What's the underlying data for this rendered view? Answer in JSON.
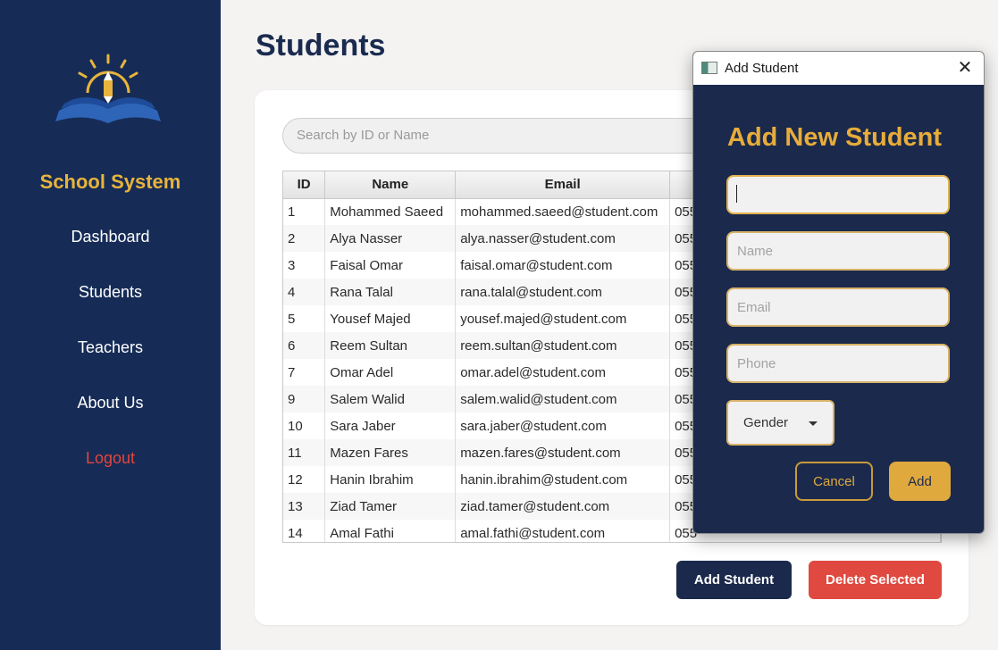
{
  "sidebar": {
    "brand": "School System",
    "items": [
      {
        "label": "Dashboard"
      },
      {
        "label": "Students"
      },
      {
        "label": "Teachers"
      },
      {
        "label": "About Us"
      },
      {
        "label": "Logout"
      }
    ]
  },
  "main": {
    "title": "Students",
    "search_placeholder": "Search by ID or Name",
    "columns": [
      "ID",
      "Name",
      "Email",
      ""
    ],
    "rows": [
      {
        "id": "1",
        "name": "Mohammed Saeed",
        "email": "mohammed.saeed@student.com",
        "phone": "055"
      },
      {
        "id": "2",
        "name": "Alya Nasser",
        "email": "alya.nasser@student.com",
        "phone": "055"
      },
      {
        "id": "3",
        "name": "Faisal Omar",
        "email": "faisal.omar@student.com",
        "phone": "055"
      },
      {
        "id": "4",
        "name": "Rana Talal",
        "email": "rana.talal@student.com",
        "phone": "055"
      },
      {
        "id": "5",
        "name": "Yousef Majed",
        "email": "yousef.majed@student.com",
        "phone": "055"
      },
      {
        "id": "6",
        "name": "Reem Sultan",
        "email": "reem.sultan@student.com",
        "phone": "055"
      },
      {
        "id": "7",
        "name": "Omar Adel",
        "email": "omar.adel@student.com",
        "phone": "055"
      },
      {
        "id": "9",
        "name": "Salem Walid",
        "email": "salem.walid@student.com",
        "phone": "055"
      },
      {
        "id": "10",
        "name": "Sara Jaber",
        "email": "sara.jaber@student.com",
        "phone": "055"
      },
      {
        "id": "11",
        "name": "Mazen Fares",
        "email": "mazen.fares@student.com",
        "phone": "055"
      },
      {
        "id": "12",
        "name": "Hanin Ibrahim",
        "email": "hanin.ibrahim@student.com",
        "phone": "055"
      },
      {
        "id": "13",
        "name": "Ziad Tamer",
        "email": "ziad.tamer@student.com",
        "phone": "055"
      },
      {
        "id": "14",
        "name": "Amal Fathi",
        "email": "amal.fathi@student.com",
        "phone": "055"
      }
    ],
    "add_button": "Add Student",
    "delete_button": "Delete Selected"
  },
  "dialog": {
    "window_title": "Add Student",
    "heading": "Add New Student",
    "fields": [
      {
        "placeholder": "",
        "value": ""
      },
      {
        "placeholder": "Name",
        "value": ""
      },
      {
        "placeholder": "Email",
        "value": ""
      },
      {
        "placeholder": "Phone",
        "value": ""
      }
    ],
    "gender_label": "Gender",
    "cancel_label": "Cancel",
    "add_label": "Add"
  },
  "colors": {
    "sidebar_bg": "#162c57",
    "accent_gold": "#e8b43c",
    "logout_red": "#e2463d",
    "delete_red": "#e0493f",
    "dialog_bg": "#1b2a4c"
  },
  "icons": [
    "school-logo-icon",
    "window-app-icon",
    "close-icon",
    "dropdown-arrow-icon"
  ]
}
